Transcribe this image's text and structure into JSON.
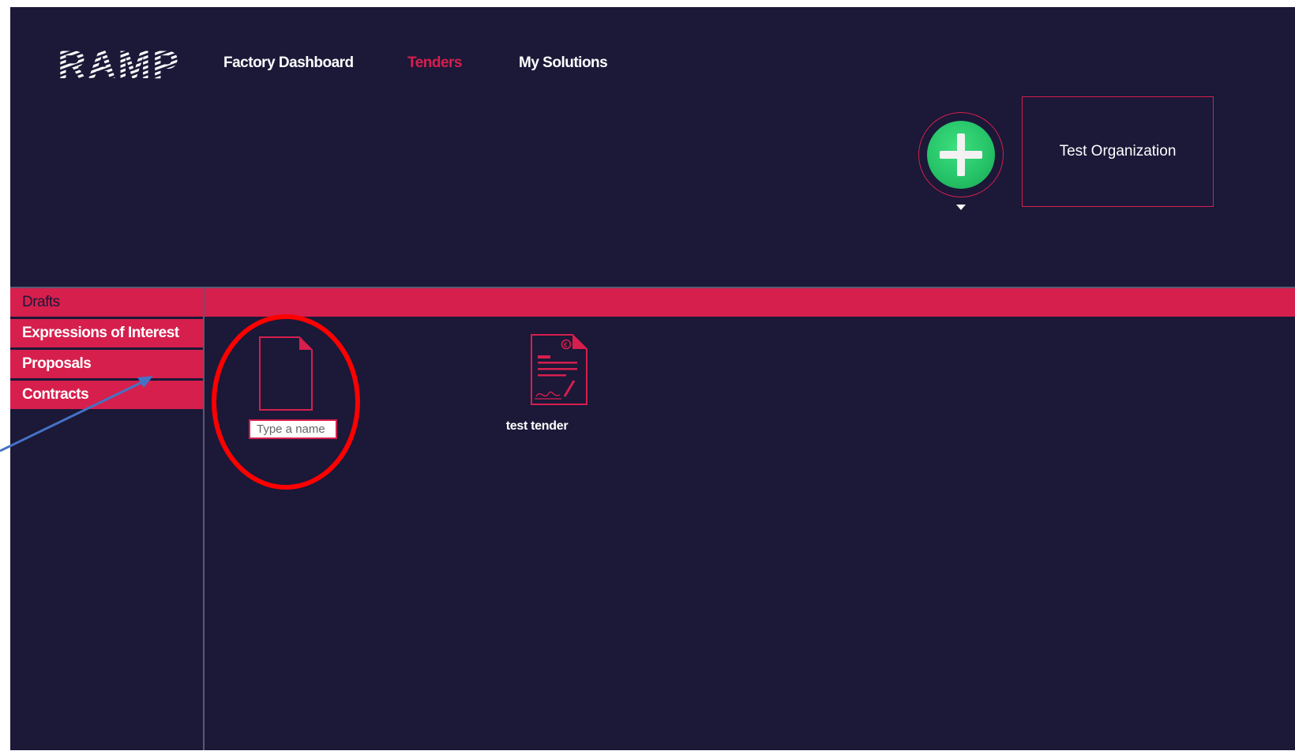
{
  "header": {
    "logo_text": "RAMP",
    "nav": [
      {
        "label": "Factory Dashboard",
        "active": false
      },
      {
        "label": "Tenders",
        "active": true
      },
      {
        "label": "My Solutions",
        "active": false
      }
    ],
    "add_button_icon": "plus-icon",
    "organization": "Test Organization"
  },
  "sidebar": {
    "items": [
      {
        "label": "Drafts",
        "active": true
      },
      {
        "label": "Expressions of Interest",
        "active": false
      },
      {
        "label": "Proposals",
        "active": false
      },
      {
        "label": "Contracts",
        "active": false
      }
    ]
  },
  "main": {
    "new_document": {
      "icon": "blank-document-icon",
      "input_value": "",
      "input_placeholder": "Type a name"
    },
    "documents": [
      {
        "name": "test tender",
        "icon": "signed-contract-icon"
      }
    ]
  },
  "annotations": {
    "highlight_color": "#ff0000",
    "arrow_color": "#4472c4"
  },
  "colors": {
    "background": "#1b1838",
    "accent": "#d61f4d",
    "add_button": "#27c469",
    "text": "#ffffff"
  }
}
